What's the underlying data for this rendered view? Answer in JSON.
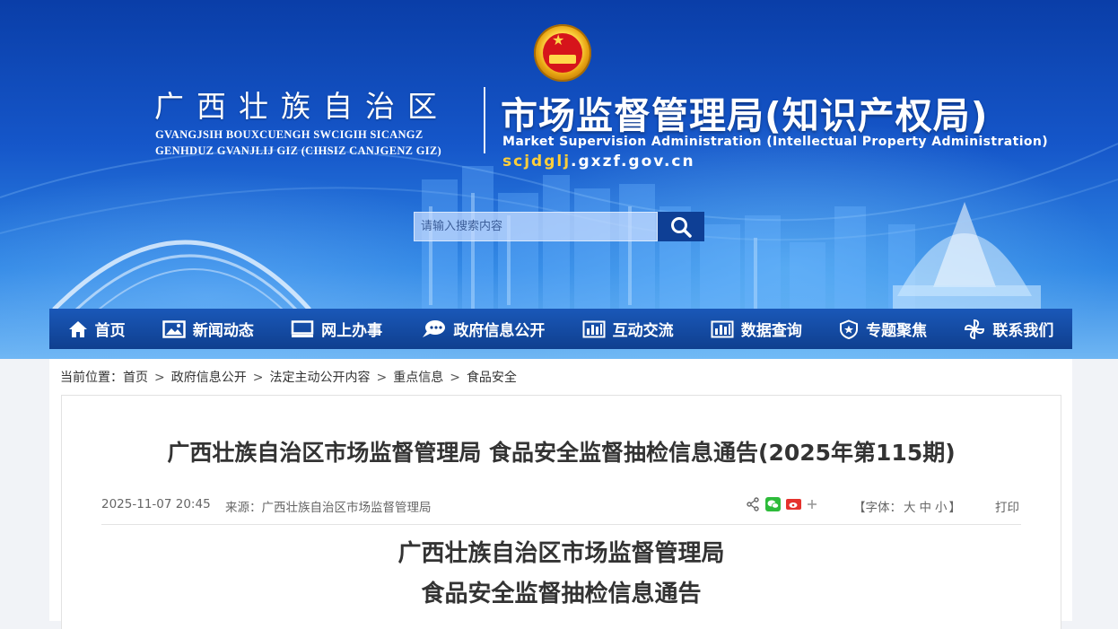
{
  "header": {
    "region_cn": "广西壮族自治区",
    "region_zh_line1": "GVANGJSIH BOUXCUENGH SWCIGIH SICANGZ",
    "region_zh_line2": "GENHDUZ GVANJLIJ GIZ (CIHSIZ CANJGENZ GIZ)",
    "bureau_cn": "市场监督管理局(知识产权局)",
    "bureau_en": "Market Supervision Administration  (Intellectual Property Administration)",
    "domain_prefix": "scjdglj",
    "domain_suffix": ".gxzf.gov.cn"
  },
  "search": {
    "placeholder": "请输入搜索内容"
  },
  "nav": {
    "items": [
      {
        "label": "首页",
        "icon": "home-icon"
      },
      {
        "label": "新闻动态",
        "icon": "picture-icon"
      },
      {
        "label": "网上办事",
        "icon": "monitor-icon"
      },
      {
        "label": "政府信息公开",
        "icon": "chat-icon"
      },
      {
        "label": "互动交流",
        "icon": "bar-chart-icon"
      },
      {
        "label": "数据查询",
        "icon": "bar-chart-icon"
      },
      {
        "label": "专题聚焦",
        "icon": "shield-icon"
      },
      {
        "label": "联系我们",
        "icon": "pinwheel-icon"
      }
    ]
  },
  "breadcrumb": {
    "prefix": "当前位置：",
    "items": [
      "首页",
      "政府信息公开",
      "法定主动公开内容",
      "重点信息",
      "食品安全"
    ],
    "separator": ">"
  },
  "article": {
    "title": "广西壮族自治区市场监督管理局 食品安全监督抽检信息通告(2025年第115期)",
    "date": "2025-11-07 20:45",
    "source": "来源：广西壮族自治区市场监督管理局",
    "font_size_label": "【字体：",
    "font_sizes": [
      "大",
      "中",
      "小"
    ],
    "font_size_close": "】",
    "print": "打印",
    "body_title_1": "广西壮族自治区市场监督管理局",
    "body_title_2": "食品安全监督抽检信息通告"
  },
  "colors": {
    "nav_bg": "#0f3f8f",
    "banner_top": "#0a3ea8",
    "domain_highlight": "#ffcf3a",
    "search_button": "#0e3f95"
  }
}
